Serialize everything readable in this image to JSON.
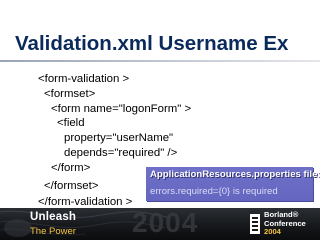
{
  "slide": {
    "title": "Validation.xml Username Ex",
    "code_lines": [
      "<form-validation >",
      "<formset>",
      "<form name=\"logonForm\" >",
      "<field",
      "property=\"userName\"",
      "depends=\"required\" />",
      "</form>",
      "</formset>",
      "</form-validation >"
    ]
  },
  "callout": {
    "heading": "ApplicationResources.properties file:",
    "body": "errors.required={0} is required"
  },
  "footer": {
    "tagline_top": "Unleash",
    "tagline_bottom": "The Power",
    "year_watermark": "2004",
    "brand_line1": "Borland®",
    "brand_line2": "Conference",
    "brand_year": "2004"
  },
  "colors": {
    "title": "#0b2a5c",
    "callout_bg": "#6466bf",
    "accent_gold": "#f2c341",
    "footer_dark": "#16181b"
  },
  "icons": {
    "borland_logo": "borland-logo-icon",
    "footer_swirl": "decorative-swirl"
  }
}
